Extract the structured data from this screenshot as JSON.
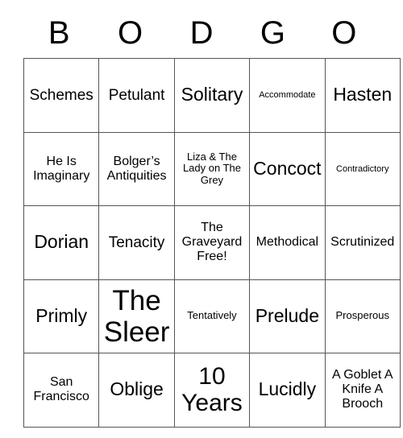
{
  "card": {
    "header": {
      "letters": [
        "B",
        "O",
        "D",
        "G",
        "O"
      ]
    },
    "rows": [
      {
        "cells": [
          {
            "text": "Schemes",
            "size": "fs-lg"
          },
          {
            "text": "Petulant",
            "size": "fs-lg"
          },
          {
            "text": "Solitary",
            "size": "fs-xl"
          },
          {
            "text": "Accommodate",
            "size": "fs-xs"
          },
          {
            "text": "Hasten",
            "size": "fs-xl"
          }
        ]
      },
      {
        "cells": [
          {
            "text": "He Is Imaginary",
            "size": "fs-md"
          },
          {
            "text": "Bolger’s Antiquities",
            "size": "fs-md"
          },
          {
            "text": "Liza & The Lady on The Grey",
            "size": "fs-sm"
          },
          {
            "text": "Concoct",
            "size": "fs-xl"
          },
          {
            "text": "Contradictory",
            "size": "fs-xs"
          }
        ]
      },
      {
        "cells": [
          {
            "text": "Dorian",
            "size": "fs-xl"
          },
          {
            "text": "Tenacity",
            "size": "fs-lg"
          },
          {
            "text": "The Graveyard Free!",
            "size": "fs-md"
          },
          {
            "text": "Methodical",
            "size": "fs-md"
          },
          {
            "text": "Scrutinized",
            "size": "fs-md"
          }
        ]
      },
      {
        "cells": [
          {
            "text": "Primly",
            "size": "fs-xl"
          },
          {
            "text": "The Sleer",
            "size": "fs-huge"
          },
          {
            "text": "Tentatively",
            "size": "fs-sm"
          },
          {
            "text": "Prelude",
            "size": "fs-xl"
          },
          {
            "text": "Prosperous",
            "size": "fs-sm"
          }
        ]
      },
      {
        "cells": [
          {
            "text": "San Francisco",
            "size": "fs-md"
          },
          {
            "text": "Oblige",
            "size": "fs-xl"
          },
          {
            "text": "10 Years",
            "size": "fs-xxl"
          },
          {
            "text": "Lucidly",
            "size": "fs-xl"
          },
          {
            "text": "A Goblet A Knife A Brooch",
            "size": "fs-md"
          }
        ]
      }
    ],
    "colors": {
      "text": "#000000",
      "grid_line": "#555555",
      "background": "#ffffff"
    }
  }
}
